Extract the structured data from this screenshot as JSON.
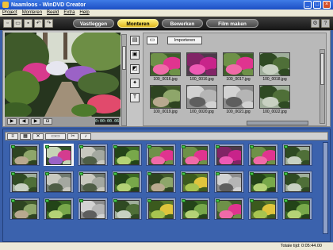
{
  "window": {
    "title": "Naamloos - WinDVD Creator"
  },
  "menu": [
    "Project",
    "Monteren",
    "Beeld",
    "Extra",
    "Help"
  ],
  "tabs": [
    {
      "label": "Vastleggen",
      "active": false
    },
    {
      "label": "Monteren",
      "active": true
    },
    {
      "label": "Bewerken",
      "active": false
    },
    {
      "label": "Film maken",
      "active": false
    }
  ],
  "preview": {
    "timecode": "0:00:00.06"
  },
  "library": {
    "import_label": "Importeren",
    "items": [
      {
        "caption": "100_0016.jpg",
        "scene": "pink"
      },
      {
        "caption": "100_0016.jpg",
        "scene": "magenta"
      },
      {
        "caption": "100_0017.jpg",
        "scene": "pink"
      },
      {
        "caption": "100_0018.jpg",
        "scene": "trees"
      },
      {
        "caption": "100_0019.jpg",
        "scene": "path"
      },
      {
        "caption": "100_0020.jpg",
        "scene": "gray"
      },
      {
        "caption": "100_0021.jpg",
        "scene": "gray"
      },
      {
        "caption": "100_0022.jpg",
        "scene": "trees"
      }
    ]
  },
  "storyboard": {
    "cells": [
      "path",
      "garden",
      "rocks",
      "green",
      "pink",
      "pink",
      "magenta",
      "pink",
      "trees",
      "trees",
      "rocks",
      "rocks",
      "green",
      "path",
      "yellow",
      "gray",
      "green",
      "trees",
      "path",
      "green",
      "gray",
      "trees",
      "yellow",
      "green",
      "pink",
      "yellow",
      "green"
    ]
  },
  "status": {
    "text": "Totale tijd: 0:05:44.00"
  },
  "colors": {
    "accent": "#f2d23a",
    "storyboard_bg": "#3b62ad",
    "titlebar": "#2558d6"
  }
}
